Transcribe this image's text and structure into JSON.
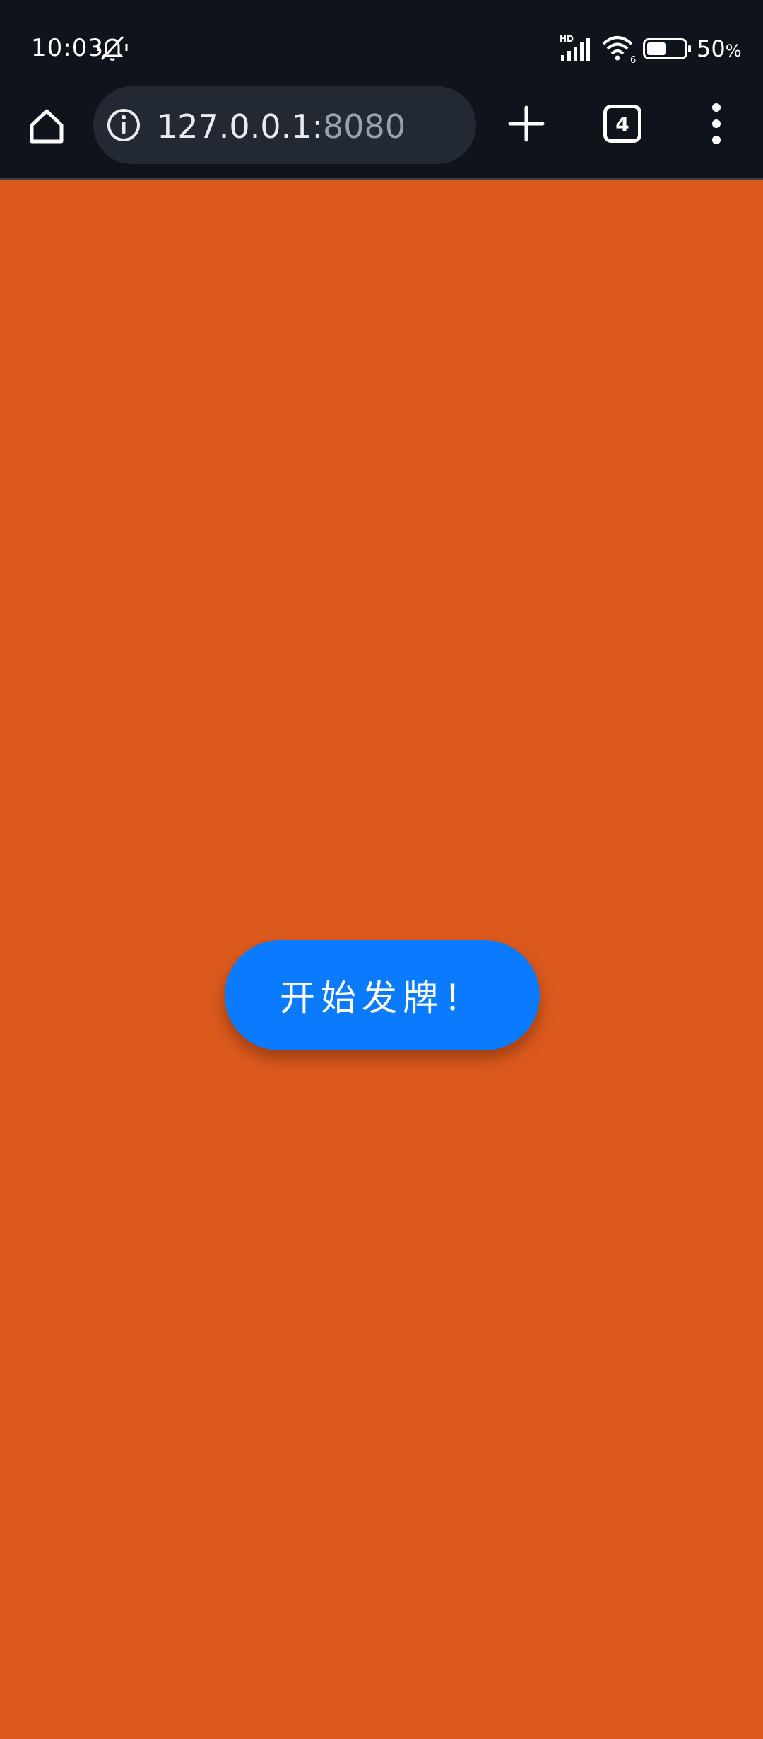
{
  "status_bar": {
    "time": "10:03",
    "network_label": "HD",
    "wifi_badge": "6",
    "battery_percent": "50",
    "battery_percent_sign": "%",
    "battery_level": 0.5,
    "icons": [
      "mute-vibrate-icon",
      "signal-icon",
      "wifi-icon",
      "battery-icon"
    ]
  },
  "browser": {
    "url_host": "127.0.0.1:",
    "url_port": "8080",
    "tab_count": "4",
    "icons": [
      "home-icon",
      "site-info-icon",
      "new-tab-icon",
      "tab-switcher-icon",
      "overflow-menu-icon"
    ]
  },
  "page": {
    "start_button_label": "开始发牌！"
  },
  "colors": {
    "page_background": "#DC5A1E",
    "chrome_background": "#0F141C",
    "url_bar_background": "#232933",
    "button_background": "#0A7BFF",
    "button_text": "#FFFFFF"
  }
}
